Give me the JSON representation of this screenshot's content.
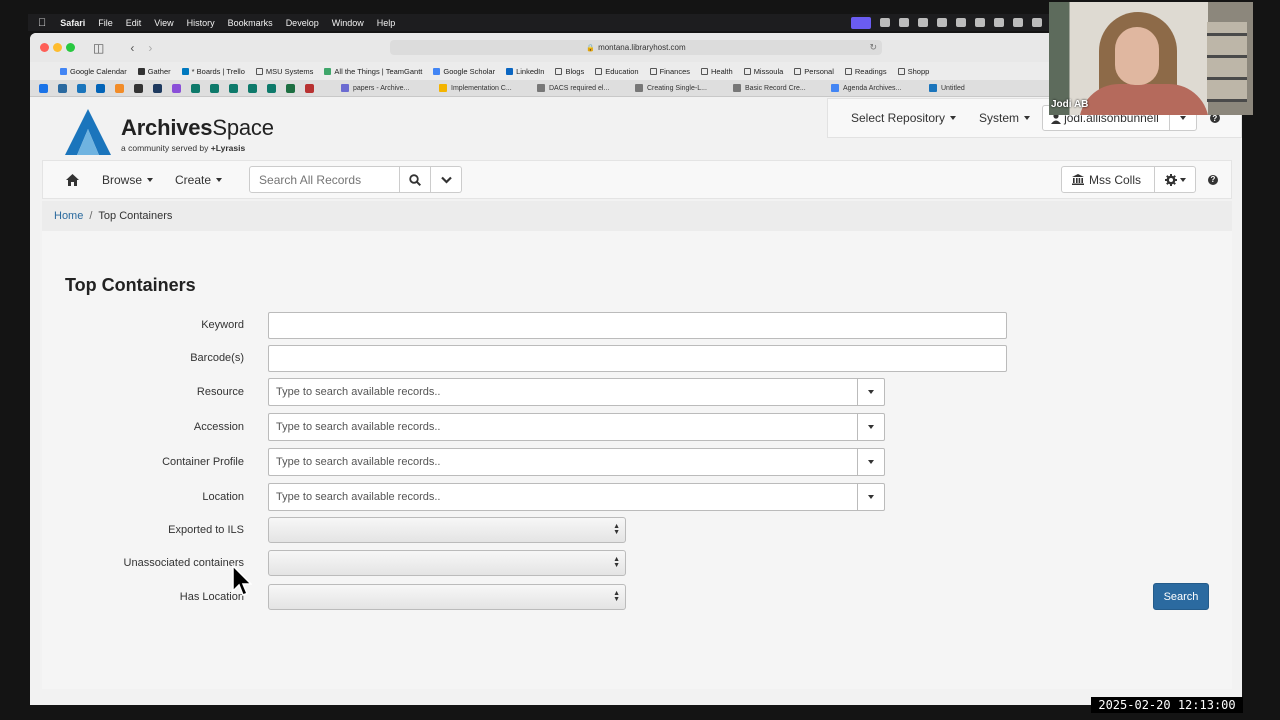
{
  "menubar": {
    "app": "Safari",
    "items": [
      "File",
      "Edit",
      "View",
      "History",
      "Bookmarks",
      "Develop",
      "Window",
      "Help"
    ]
  },
  "browser": {
    "url": "montana.libraryhost.com",
    "bookmarks": [
      "Google Calendar",
      "Gather",
      "* Boards | Trello",
      "MSU Systems",
      "All the Things | TeamGantt",
      "Google Scholar",
      "LinkedIn",
      "Blogs",
      "Education",
      "Finances",
      "Health",
      "Missoula",
      "Personal",
      "Readings",
      "Shopp"
    ],
    "tabs": [
      "papers - Archive...",
      "Implementation C...",
      "DACS required el...",
      "Creating Single-L...",
      "Basic Record Cre...",
      "Agenda Archives...",
      "Untitled"
    ]
  },
  "header": {
    "logo_bold": "Archives",
    "logo_rest": "Space",
    "tagline_pre": "a community served by ",
    "tagline_brand": "+Lyrasis",
    "select_repository": "Select Repository",
    "system": "System",
    "user": "jodi.allisonbunnell"
  },
  "nav": {
    "browse": "Browse",
    "create": "Create",
    "search_placeholder": "Search All Records",
    "repo_button": "Mss Colls"
  },
  "breadcrumb": {
    "home": "Home",
    "separator": "/",
    "current": "Top Containers"
  },
  "form": {
    "title": "Top Containers",
    "keyword_label": "Keyword",
    "barcode_label": "Barcode(s)",
    "resource_label": "Resource",
    "accession_label": "Accession",
    "container_profile_label": "Container Profile",
    "location_label": "Location",
    "typeahead_placeholder": "Type to search available records..",
    "exported_label": "Exported to ILS",
    "unassociated_label": "Unassociated containers",
    "has_location_label": "Has Location",
    "search_button": "Search"
  },
  "webcam": {
    "name": "Jodi AB"
  },
  "timestamp": "2025-02-20 12:13:00"
}
